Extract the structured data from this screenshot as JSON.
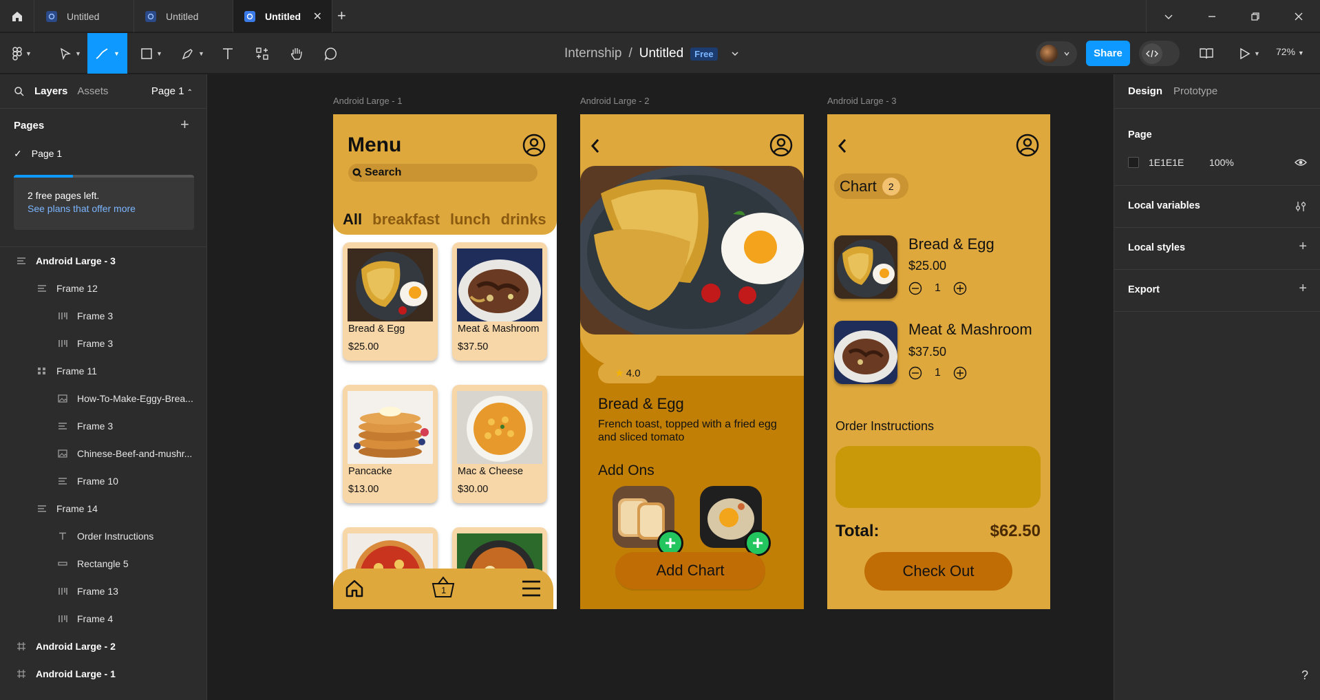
{
  "tabs": [
    {
      "label": "Untitled",
      "active": false
    },
    {
      "label": "Untitled",
      "active": false
    },
    {
      "label": "Untitled",
      "active": true
    }
  ],
  "breadcrumb": {
    "project": "Internship",
    "separator": "/",
    "file": "Untitled",
    "plan_badge": "Free"
  },
  "toolbar": {
    "share_label": "Share",
    "zoom": "72%"
  },
  "left_panel": {
    "tab_layers": "Layers",
    "tab_assets": "Assets",
    "page_selector": "Page 1",
    "pages_title": "Pages",
    "pages": [
      "Page 1"
    ],
    "quota_text": "2 free pages left.",
    "quota_link": "See plans that offer more",
    "quota_progress": 0.33,
    "layers": [
      {
        "label": "Android Large - 3",
        "icon": "frame-auto-layout-icon",
        "depth": 0
      },
      {
        "label": "Frame 12",
        "icon": "auto-layout-vertical-icon",
        "depth": 1
      },
      {
        "label": "Frame 3",
        "icon": "auto-layout-horizontal-icon",
        "depth": 2
      },
      {
        "label": "Frame 3",
        "icon": "auto-layout-horizontal-icon",
        "depth": 2
      },
      {
        "label": "Frame 11",
        "icon": "grid-layout-icon",
        "depth": 1
      },
      {
        "label": "How-To-Make-Eggy-Brea...",
        "icon": "image-icon",
        "depth": 2
      },
      {
        "label": "Frame 3",
        "icon": "auto-layout-vertical-icon",
        "depth": 2
      },
      {
        "label": "Chinese-Beef-and-mushr...",
        "icon": "image-icon",
        "depth": 2
      },
      {
        "label": "Frame 10",
        "icon": "auto-layout-vertical-icon",
        "depth": 2
      },
      {
        "label": "Frame 14",
        "icon": "auto-layout-vertical-icon",
        "depth": 1
      },
      {
        "label": "Order Instructions",
        "icon": "text-icon",
        "depth": 2
      },
      {
        "label": "Rectangle 5",
        "icon": "rectangle-icon",
        "depth": 2
      },
      {
        "label": "Frame 13",
        "icon": "auto-layout-horizontal-icon",
        "depth": 2
      },
      {
        "label": "Frame 4",
        "icon": "auto-layout-horizontal-icon",
        "depth": 2
      },
      {
        "label": "Android Large - 2",
        "icon": "frame-icon",
        "depth": 0
      },
      {
        "label": "Android Large - 1",
        "icon": "frame-icon",
        "depth": 0
      }
    ]
  },
  "frames": {
    "f1": {
      "label": "Android Large - 1",
      "title": "Menu",
      "search": "Search",
      "categories": [
        "All",
        "breakfast",
        "lunch",
        "drinks"
      ],
      "items": [
        {
          "name": "Bread & Egg",
          "price": "$25.00"
        },
        {
          "name": "Meat & Mashroom",
          "price": "$37.50"
        },
        {
          "name": "Pancacke",
          "price": "$13.00"
        },
        {
          "name": "Mac & Cheese",
          "price": "$30.00"
        }
      ],
      "basket_count": "1"
    },
    "f2": {
      "label": "Android Large - 2",
      "rating": "4.0",
      "title": "Bread & Egg",
      "description": "French toast, topped with a fried egg and sliced tomato",
      "addons_title": "Add Ons",
      "button": "Add Chart"
    },
    "f3": {
      "label": "Android Large - 3",
      "chart_label": "Chart",
      "chart_count": "2",
      "items": [
        {
          "name": "Bread & Egg",
          "price": "$25.00",
          "qty": "1"
        },
        {
          "name": "Meat & Mashroom",
          "price": "$37.50",
          "qty": "1"
        }
      ],
      "order_instructions": "Order  Instructions",
      "total_label": "Total:",
      "total_value": "$62.50",
      "button": "Check Out"
    }
  },
  "right_panel": {
    "tab_design": "Design",
    "tab_prototype": "Prototype",
    "page_title": "Page",
    "page_color": "1E1E1E",
    "page_opacity": "100%",
    "local_variables": "Local variables",
    "local_styles": "Local styles",
    "export": "Export"
  },
  "help": "?",
  "colors": {
    "accent": "#0d99ff",
    "frame_yellow": "#dfa83c",
    "frame_orange": "#c17f06",
    "button": "#c06d06",
    "add_green": "#22c55e"
  }
}
